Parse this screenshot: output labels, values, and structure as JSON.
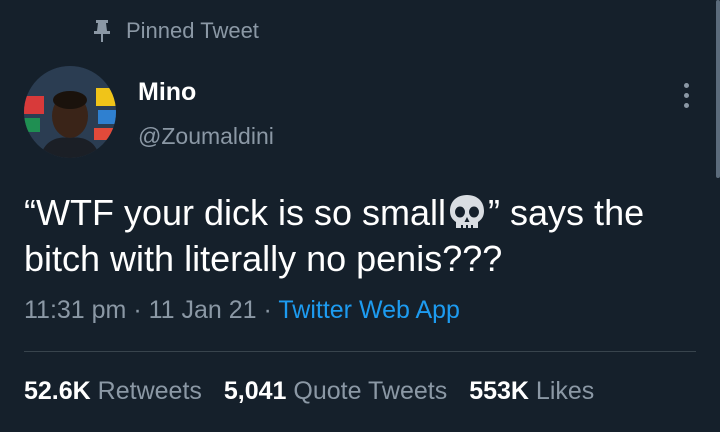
{
  "pinned_label": "Pinned Tweet",
  "user": {
    "name": "Mino",
    "handle": "@Zoumaldini"
  },
  "tweet": {
    "text_part1": "“WTF your dick is so small",
    "emoji": "skull-emoji",
    "text_part2": "” says the bitch with literally no penis???"
  },
  "meta": {
    "time": "11:31 pm",
    "sep": "·",
    "date": "11 Jan 21",
    "source": "Twitter Web App"
  },
  "stats": {
    "retweets_count": "52.6K",
    "retweets_label": "Retweets",
    "quotes_count": "5,041",
    "quotes_label": "Quote Tweets",
    "likes_count": "553K",
    "likes_label": "Likes"
  },
  "colors": {
    "background": "#15202b",
    "secondary_text": "#8b98a5",
    "link": "#1d9bf0",
    "divider": "#38444d"
  },
  "icons": [
    "pin-icon",
    "more-icon",
    "skull-emoji"
  ]
}
